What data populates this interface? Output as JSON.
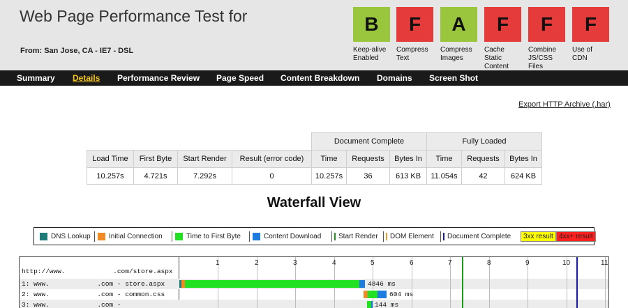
{
  "header": {
    "title": "Web Page Performance Test for",
    "from": "From: San Jose, CA - IE7 - DSL"
  },
  "grades": [
    {
      "grade": "B",
      "label": "Keep-alive Enabled",
      "color": "#9ac63e"
    },
    {
      "grade": "F",
      "label": "Compress Text",
      "color": "#e63b3b"
    },
    {
      "grade": "A",
      "label": "Compress Images",
      "color": "#9ac63e"
    },
    {
      "grade": "F",
      "label": "Cache Static Content",
      "color": "#e63b3b"
    },
    {
      "grade": "F",
      "label": "Combine JS/CSS Files",
      "color": "#e63b3b"
    },
    {
      "grade": "F",
      "label": "Use of CDN",
      "color": "#e63b3b"
    }
  ],
  "nav": {
    "items": [
      "Summary",
      "Details",
      "Performance Review",
      "Page Speed",
      "Content Breakdown",
      "Domains",
      "Screen Shot"
    ],
    "active": "Details"
  },
  "export_link": "Export HTTP Archive (.har)",
  "metrics": {
    "group_document_complete": "Document Complete",
    "group_fully_loaded": "Fully Loaded",
    "headers": [
      "Load Time",
      "First Byte",
      "Start Render",
      "Result (error code)",
      "Time",
      "Requests",
      "Bytes In",
      "Time",
      "Requests",
      "Bytes In"
    ],
    "values": [
      "10.257s",
      "4.721s",
      "7.292s",
      "0",
      "10.257s",
      "36",
      "613 KB",
      "11.054s",
      "42",
      "624 KB"
    ]
  },
  "waterfall": {
    "title": "Waterfall View",
    "legend": [
      {
        "label": "DNS Lookup",
        "kind": "swatch",
        "color": "#1f7a7a"
      },
      {
        "label": "Initial Connection",
        "kind": "swatch",
        "color": "#f08a24"
      },
      {
        "label": "Time to First Byte",
        "kind": "swatch",
        "color": "#22e022"
      },
      {
        "label": "Content Download",
        "kind": "swatch",
        "color": "#1e7be0"
      },
      {
        "label": "Start Render",
        "kind": "line",
        "color": "#1a9a1a"
      },
      {
        "label": "DOM Element",
        "kind": "line",
        "color": "#f0a030"
      },
      {
        "label": "Document Complete",
        "kind": "line",
        "color": "#1a1aa0"
      },
      {
        "label": "3xx result",
        "kind": "fill",
        "color": "#ffff00"
      },
      {
        "label": "4xx+ result",
        "kind": "fill",
        "color": "#ff2020"
      }
    ],
    "ticks": [
      "1",
      "2",
      "3",
      "4",
      "5",
      "6",
      "7",
      "8",
      "9",
      "10",
      "11"
    ],
    "max_seconds": 11.1,
    "start_render_s": 7.292,
    "document_complete_s": 10.257,
    "rows": [
      {
        "url": "http://www.            .com/store.aspx"
      },
      {
        "url": "1: www.            .com - store.aspx",
        "start": 0,
        "dns": 0.05,
        "connect": 0.1,
        "ttfb": 4.5,
        "download": 0.15,
        "ms": "4846 ms"
      },
      {
        "url": "2: www.            .com - common.css",
        "start": 4.76,
        "dns": 0,
        "connect": 0.1,
        "ttfb": 0.25,
        "download": 0.25,
        "ms": "604 ms"
      },
      {
        "url": "3: www.            .com -",
        "start": 4.84,
        "dns": 0,
        "connect": 0,
        "ttfb": 0.12,
        "download": 0.02,
        "ms": "144 ms"
      }
    ]
  }
}
